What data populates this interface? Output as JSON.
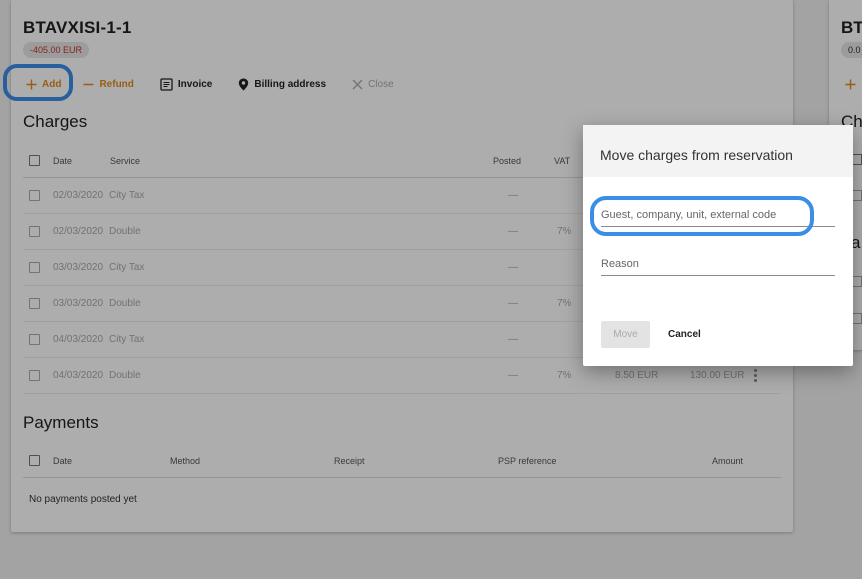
{
  "folio": {
    "title": "BTAVXISI-1-1",
    "balance": "-405.00 EUR"
  },
  "toolbar": {
    "add_label": "Add",
    "refund_label": "Refund",
    "invoice_label": "Invoice",
    "billing_label": "Billing address",
    "close_label": "Close"
  },
  "charges": {
    "title": "Charges",
    "headers": {
      "date": "Date",
      "service": "Service",
      "posted": "Posted",
      "vat": "VAT"
    },
    "rows": [
      {
        "date": "02/03/2020",
        "service": "City Tax",
        "posted": "—",
        "vat": "",
        "tax": "",
        "amount": ""
      },
      {
        "date": "02/03/2020",
        "service": "Double",
        "posted": "—",
        "vat": "7%",
        "tax": "",
        "amount": ""
      },
      {
        "date": "03/03/2020",
        "service": "City Tax",
        "posted": "—",
        "vat": "",
        "tax": "",
        "amount": ""
      },
      {
        "date": "03/03/2020",
        "service": "Double",
        "posted": "—",
        "vat": "7%",
        "tax": "",
        "amount": ""
      },
      {
        "date": "04/03/2020",
        "service": "City Tax",
        "posted": "—",
        "vat": "",
        "tax": "",
        "amount": ""
      },
      {
        "date": "04/03/2020",
        "service": "Double",
        "posted": "—",
        "vat": "7%",
        "tax": "8.50 EUR",
        "amount": "130.00 EUR"
      }
    ]
  },
  "payments": {
    "title": "Payments",
    "headers": {
      "date": "Date",
      "method": "Method",
      "receipt": "Receipt",
      "psp": "PSP reference",
      "amount": "Amount"
    },
    "empty": "No payments posted yet"
  },
  "second_folio": {
    "title": "BT",
    "balance": "0.0",
    "section_a": "Ch",
    "section_b": "a"
  },
  "modal": {
    "title": "Move charges from reservation",
    "target_placeholder": "Guest, company, unit, external code",
    "target_value": "",
    "reason_placeholder": "Reason",
    "reason_value": "",
    "move_label": "Move",
    "cancel_label": "Cancel"
  },
  "colors": {
    "accent_orange": "#e08a1e",
    "highlight_blue": "#3a8ee6",
    "negative_red": "#c0392b"
  }
}
